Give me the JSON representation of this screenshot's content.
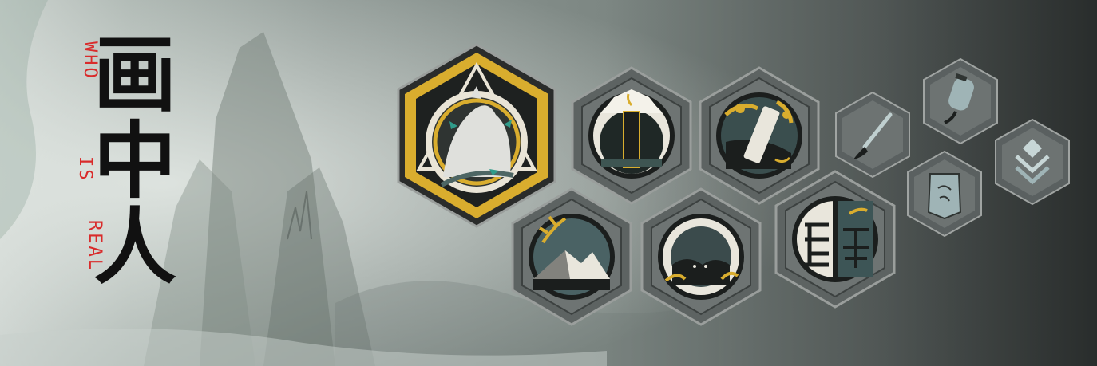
{
  "title": {
    "chinese_chars": [
      "画",
      "中",
      "人"
    ],
    "english_words": [
      "WHO",
      "IS",
      "REAL"
    ]
  },
  "colors": {
    "accent_red": "#d92b2b",
    "gold": "#d9ad2e",
    "frame_gray": "#5d6362",
    "teal": "#2f9b8a"
  },
  "badges": [
    {
      "id": "mountain",
      "icon": "white-fox-mountain-icon",
      "tier": "gold-featured"
    },
    {
      "id": "talisman",
      "icon": "glowing-talisman-stele-icon",
      "tier": "silver"
    },
    {
      "id": "scroll",
      "icon": "scroll-with-ginkgo-icon",
      "tier": "silver"
    },
    {
      "id": "brush",
      "icon": "calligraphy-brush-icon",
      "tier": "bronze"
    },
    {
      "id": "lantern",
      "icon": "hanging-lantern-icon",
      "tier": "bronze"
    },
    {
      "id": "bamboo",
      "icon": "bamboo-mountain-icon",
      "tier": "silver"
    },
    {
      "id": "fret",
      "icon": "fret-pattern-cave-icon",
      "tier": "silver"
    },
    {
      "id": "seal",
      "icon": "seal-script-icon",
      "tier": "silver"
    },
    {
      "id": "tablet",
      "icon": "ink-tablet-icon",
      "tier": "bronze"
    },
    {
      "id": "stack",
      "icon": "layered-arrows-icon",
      "tier": "bronze"
    }
  ]
}
